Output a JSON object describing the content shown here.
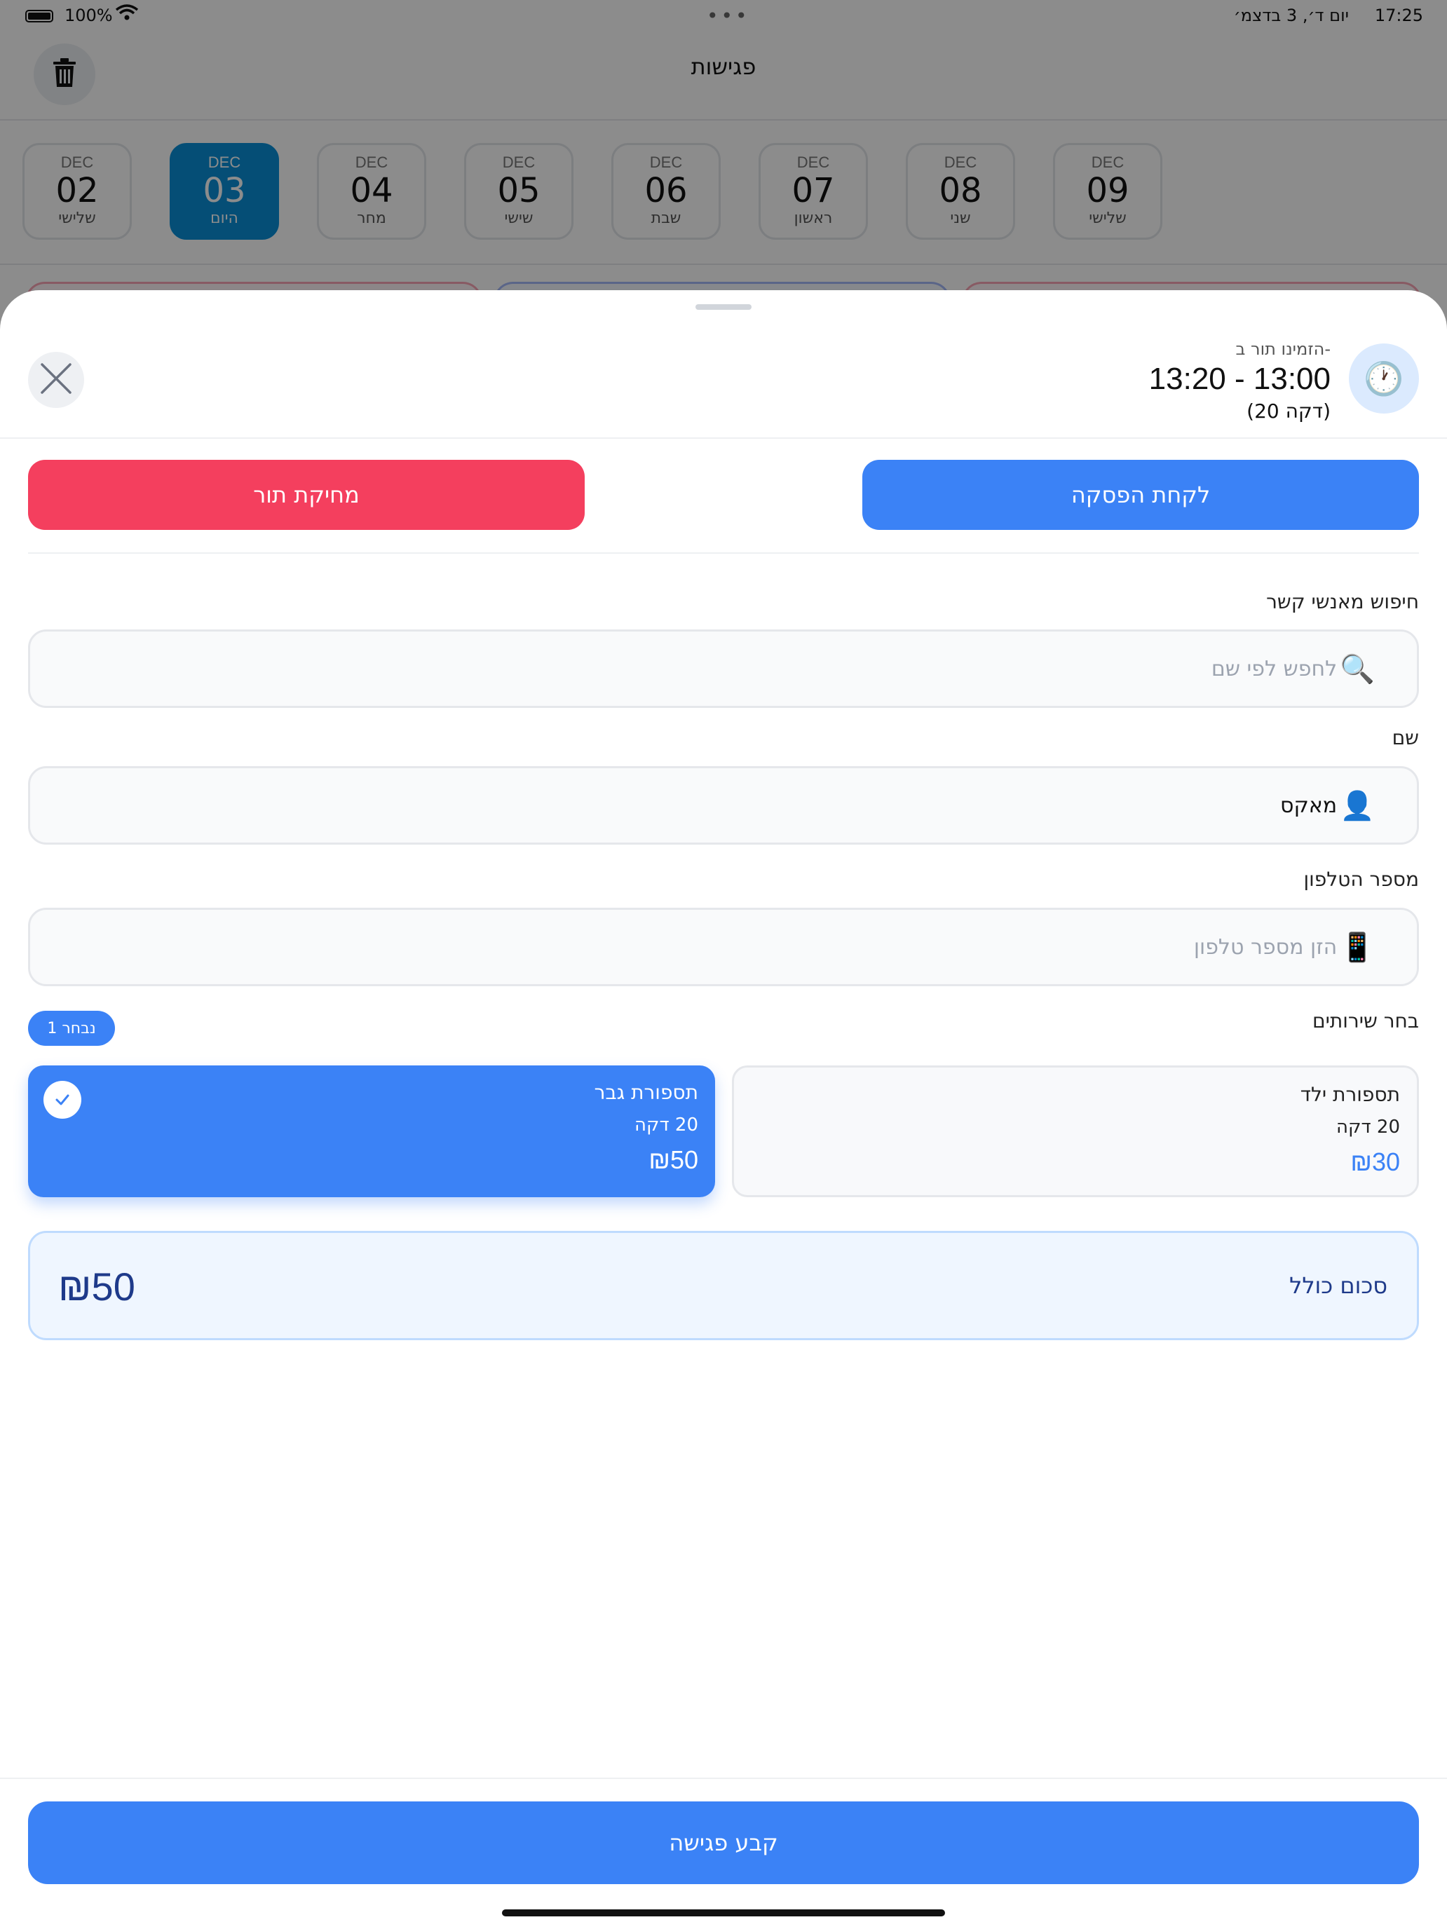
{
  "status_bar": {
    "time": "17:25",
    "date": "יום ד׳, 3 בדצמ׳",
    "battery": "100%"
  },
  "header": {
    "title": "פגישות"
  },
  "days": [
    {
      "month": "DEC",
      "day": "02",
      "weekday": "שלישי"
    },
    {
      "month": "DEC",
      "day": "03",
      "weekday": "היום"
    },
    {
      "month": "DEC",
      "day": "04",
      "weekday": "מחר"
    },
    {
      "month": "DEC",
      "day": "05",
      "weekday": "שישי"
    },
    {
      "month": "DEC",
      "day": "06",
      "weekday": "שבת"
    },
    {
      "month": "DEC",
      "day": "07",
      "weekday": "ראשון"
    },
    {
      "month": "DEC",
      "day": "08",
      "weekday": "שני"
    },
    {
      "month": "DEC",
      "day": "09",
      "weekday": "שלישי"
    }
  ],
  "sheet": {
    "booked_label": "הזמינו תור ב-",
    "booked_time": "13:20 - 13:00",
    "booked_duration": "(20 דקה)",
    "take_break_label": "לקחת הפסקה",
    "delete_label": "מחיקת תור",
    "contact_search_label": "חיפוש מאנשי קשר",
    "contact_search_placeholder": "לחפש לפי שם",
    "name_label": "שם",
    "name_value": "מאקס",
    "phone_label": "מספר הטלפון",
    "phone_placeholder": "הזן מספר טלפון",
    "services_label": "בחר שירותים",
    "selected_count": "1 נבחר",
    "services": [
      {
        "name": "תספורת גבר",
        "duration": "20 דקה",
        "price": "₪50",
        "selected": true
      },
      {
        "name": "תספורת ילד",
        "duration": "20 דקה",
        "price": "₪30",
        "selected": false
      }
    ],
    "total_label": "סכום כולל",
    "total_amount": "₪50",
    "submit_label": "קבע פגישה"
  },
  "colors": {
    "primary": "#3b82f6",
    "danger": "#f43f5e",
    "today": "#0a8fd8"
  }
}
